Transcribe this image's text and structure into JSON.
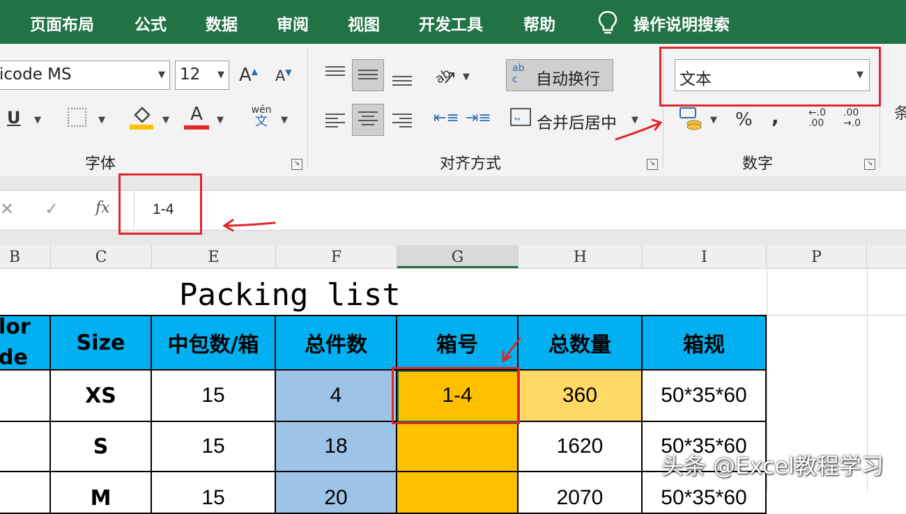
{
  "menu": {
    "items": [
      "页面布局",
      "公式",
      "数据",
      "审阅",
      "视图",
      "开发工具",
      "帮助"
    ],
    "tell_me": "操作说明搜索"
  },
  "ribbon": {
    "font": {
      "name": "icode MS",
      "size": "12",
      "group_label": "字体",
      "underline": "U",
      "grow": "A",
      "shrink": "A",
      "font_color": "A",
      "phonetic_top": "wén",
      "phonetic_bottom": "文"
    },
    "alignment": {
      "wrap_text": "自动换行",
      "wrap_icon_text": "ab c",
      "merge_center": "合并后居中",
      "group_label": "对齐方式"
    },
    "number": {
      "format": "文本",
      "percent": "%",
      "comma": ",",
      "increase_decimal_top": "←.0",
      "increase_decimal_bottom": ".00",
      "decrease_decimal_top": ".00",
      "decrease_decimal_bottom": "→.0",
      "group_label": "数字",
      "next_group_partial": "条"
    }
  },
  "formula_bar": {
    "cancel": "✕",
    "enter": "✓",
    "fx": "fx",
    "value": "1-4"
  },
  "columns": [
    "B",
    "C",
    "E",
    "F",
    "G",
    "H",
    "I",
    "P"
  ],
  "sheet": {
    "title": "Packing list",
    "headers": [
      "lor de",
      "Size",
      "中包数/箱",
      "总件数",
      "箱号",
      "总数量",
      "箱规"
    ],
    "rows": [
      [
        "",
        "XS",
        "15",
        "4",
        "1-4",
        "360",
        "50*35*60"
      ],
      [
        "",
        "S",
        "15",
        "18",
        "",
        "1620",
        "50*35*60"
      ],
      [
        "",
        "M",
        "15",
        "20",
        "",
        "2070",
        "50*35*60"
      ]
    ]
  },
  "watermark": "头条 @Excel教程学习",
  "colors": {
    "menu_bg": "#217346",
    "header_fill": "#00b0f0",
    "count_fill": "#9dc3e6",
    "box_no_fill": "#ffc000",
    "qty_fill": "#ffd966",
    "annotation": "#e0262b"
  }
}
